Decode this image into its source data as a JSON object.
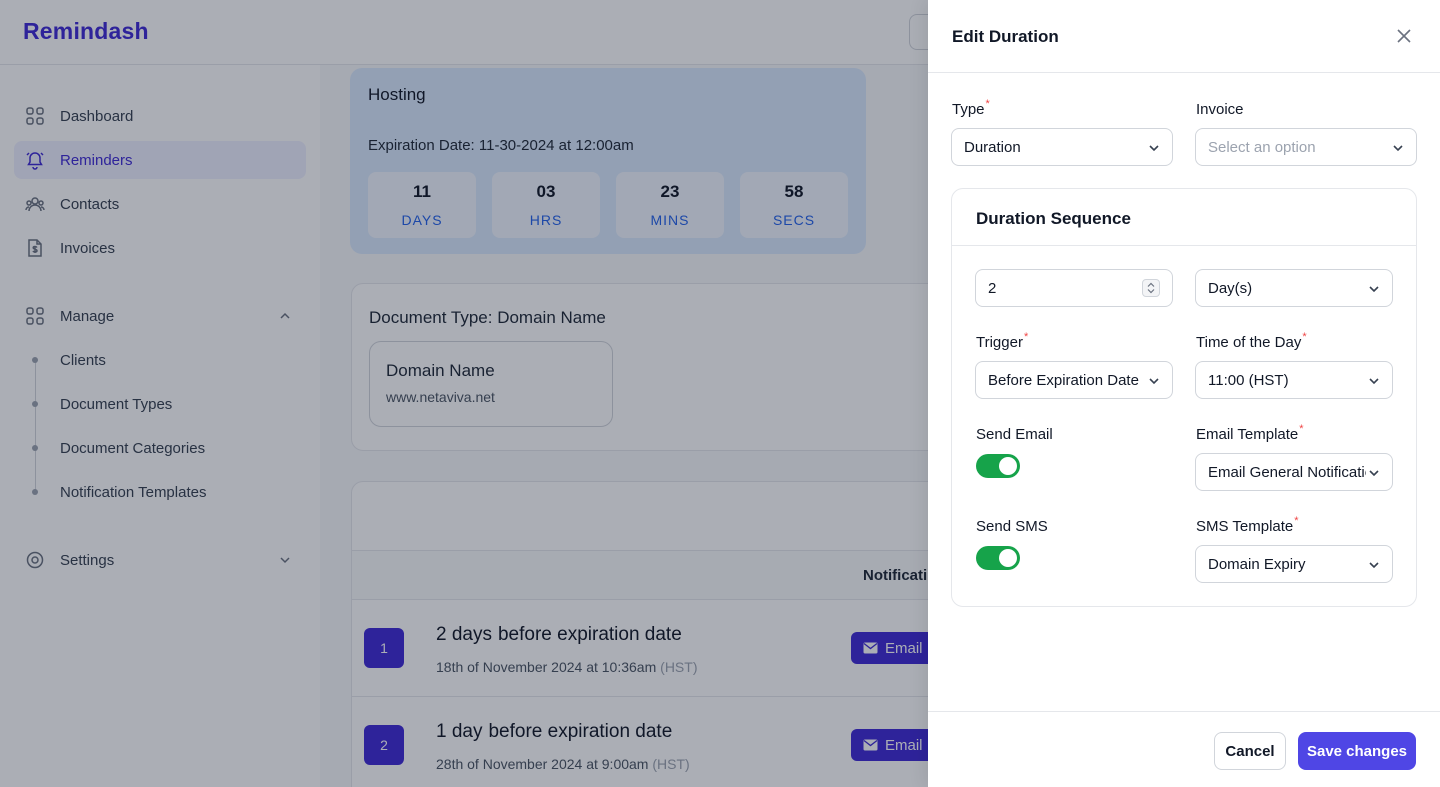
{
  "app": {
    "logo": "Remindash"
  },
  "sidebar": {
    "items": [
      {
        "label": "Dashboard",
        "icon": "grid-icon"
      },
      {
        "label": "Reminders",
        "icon": "bell-icon",
        "active": true
      },
      {
        "label": "Contacts",
        "icon": "users-icon"
      },
      {
        "label": "Invoices",
        "icon": "invoice-icon"
      }
    ],
    "manage": {
      "label": "Manage",
      "items": [
        "Clients",
        "Document Types",
        "Document Categories",
        "Notification Templates"
      ]
    },
    "settings": {
      "label": "Settings"
    }
  },
  "hosting": {
    "title": "Hosting",
    "expiration": "Expiration Date: 11-30-2024 at 12:00am",
    "countdown": [
      {
        "num": "11",
        "unit": "DAYS"
      },
      {
        "num": "03",
        "unit": "HRS"
      },
      {
        "num": "23",
        "unit": "MINS"
      },
      {
        "num": "58",
        "unit": "SECS"
      }
    ]
  },
  "document": {
    "type_label": "Document Type: Domain Name",
    "field_name": "Domain Name",
    "field_value": "www.netaviva.net"
  },
  "notifications": {
    "header": "Notificati",
    "rows": [
      {
        "index": "1",
        "lead": "2 days",
        "rest": "before expiration date",
        "date": "18th of November 2024 at 10:36am",
        "tz": "(HST)",
        "channel": "Email"
      },
      {
        "index": "2",
        "lead": "1 day",
        "rest": "before expiration date",
        "date": "28th of November 2024 at 9:00am",
        "tz": "(HST)",
        "channel": "Email"
      }
    ]
  },
  "drawer": {
    "title": "Edit Duration",
    "type_label": "Type",
    "type_value": "Duration",
    "invoice_label": "Invoice",
    "invoice_placeholder": "Select an option",
    "sequence_title": "Duration Sequence",
    "amount_value": "2",
    "unit_value": "Day(s)",
    "trigger_label": "Trigger",
    "trigger_value": "Before Expiration Date",
    "time_label": "Time of the Day",
    "time_value": "11:00 (HST)",
    "send_email_label": "Send Email",
    "send_email_on": true,
    "email_template_label": "Email Template",
    "email_template_value": "Email General Notification",
    "send_sms_label": "Send SMS",
    "send_sms_on": true,
    "sms_template_label": "SMS Template",
    "sms_template_value": "Domain Expiry",
    "cancel_label": "Cancel",
    "save_label": "Save changes"
  },
  "colors": {
    "brand": "#3f2ad6",
    "primary_button": "#4f46e5",
    "toggle_on": "#16a34a",
    "required": "#ef4444"
  }
}
